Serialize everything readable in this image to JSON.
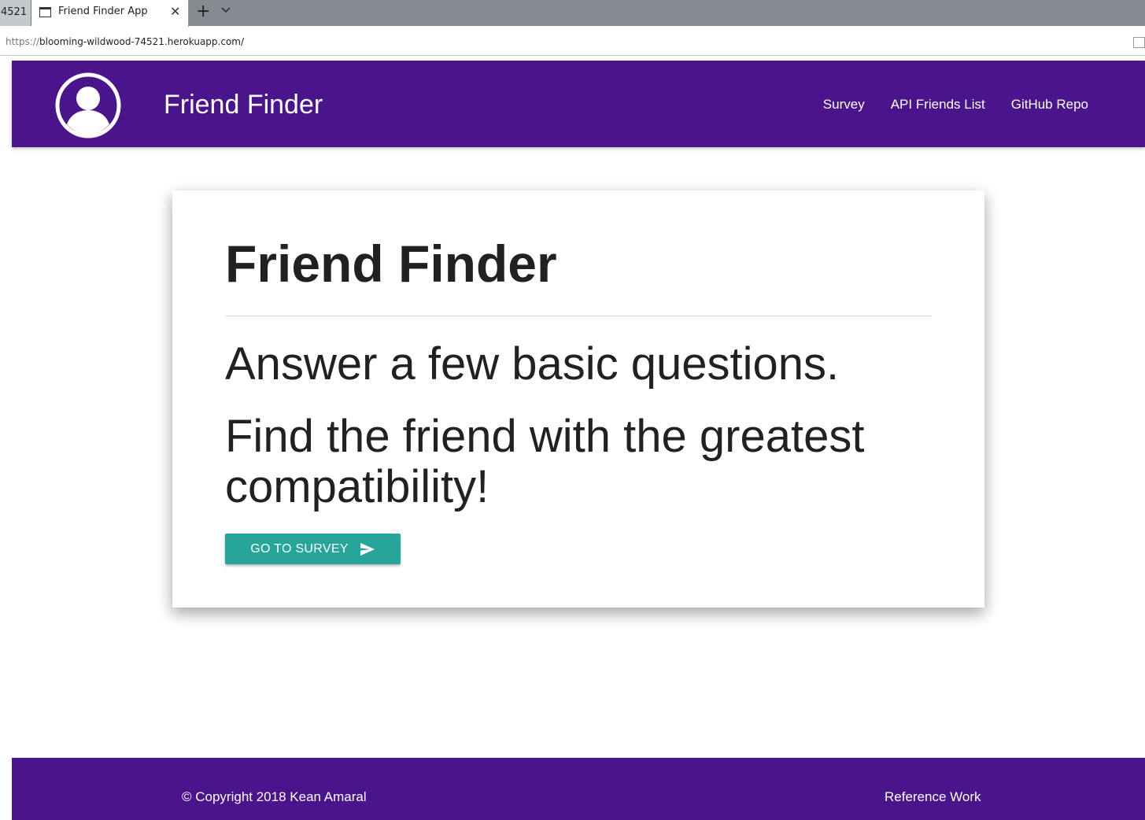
{
  "browser": {
    "prev_tab_label": "4521",
    "active_tab_title": "Friend Finder App",
    "url_scheme": "https://",
    "url_rest": "blooming-wildwood-74521.herokuapp.com/"
  },
  "navbar": {
    "brand": "Friend Finder",
    "links": [
      "Survey",
      "API Friends List",
      "GitHub Repo"
    ],
    "bg_color": "#4a148c",
    "logo_icon": "account-circle-icon"
  },
  "card": {
    "title": "Friend Finder",
    "line1": "Answer a few basic questions.",
    "line2": "Find the friend with the greatest compatibility!",
    "button_label": "GO TO SURVEY",
    "button_icon": "send-icon",
    "button_color": "#26a69a"
  },
  "footer": {
    "copyright": "© Copyright 2018 Kean Amaral",
    "reference_link": "Reference Work"
  }
}
